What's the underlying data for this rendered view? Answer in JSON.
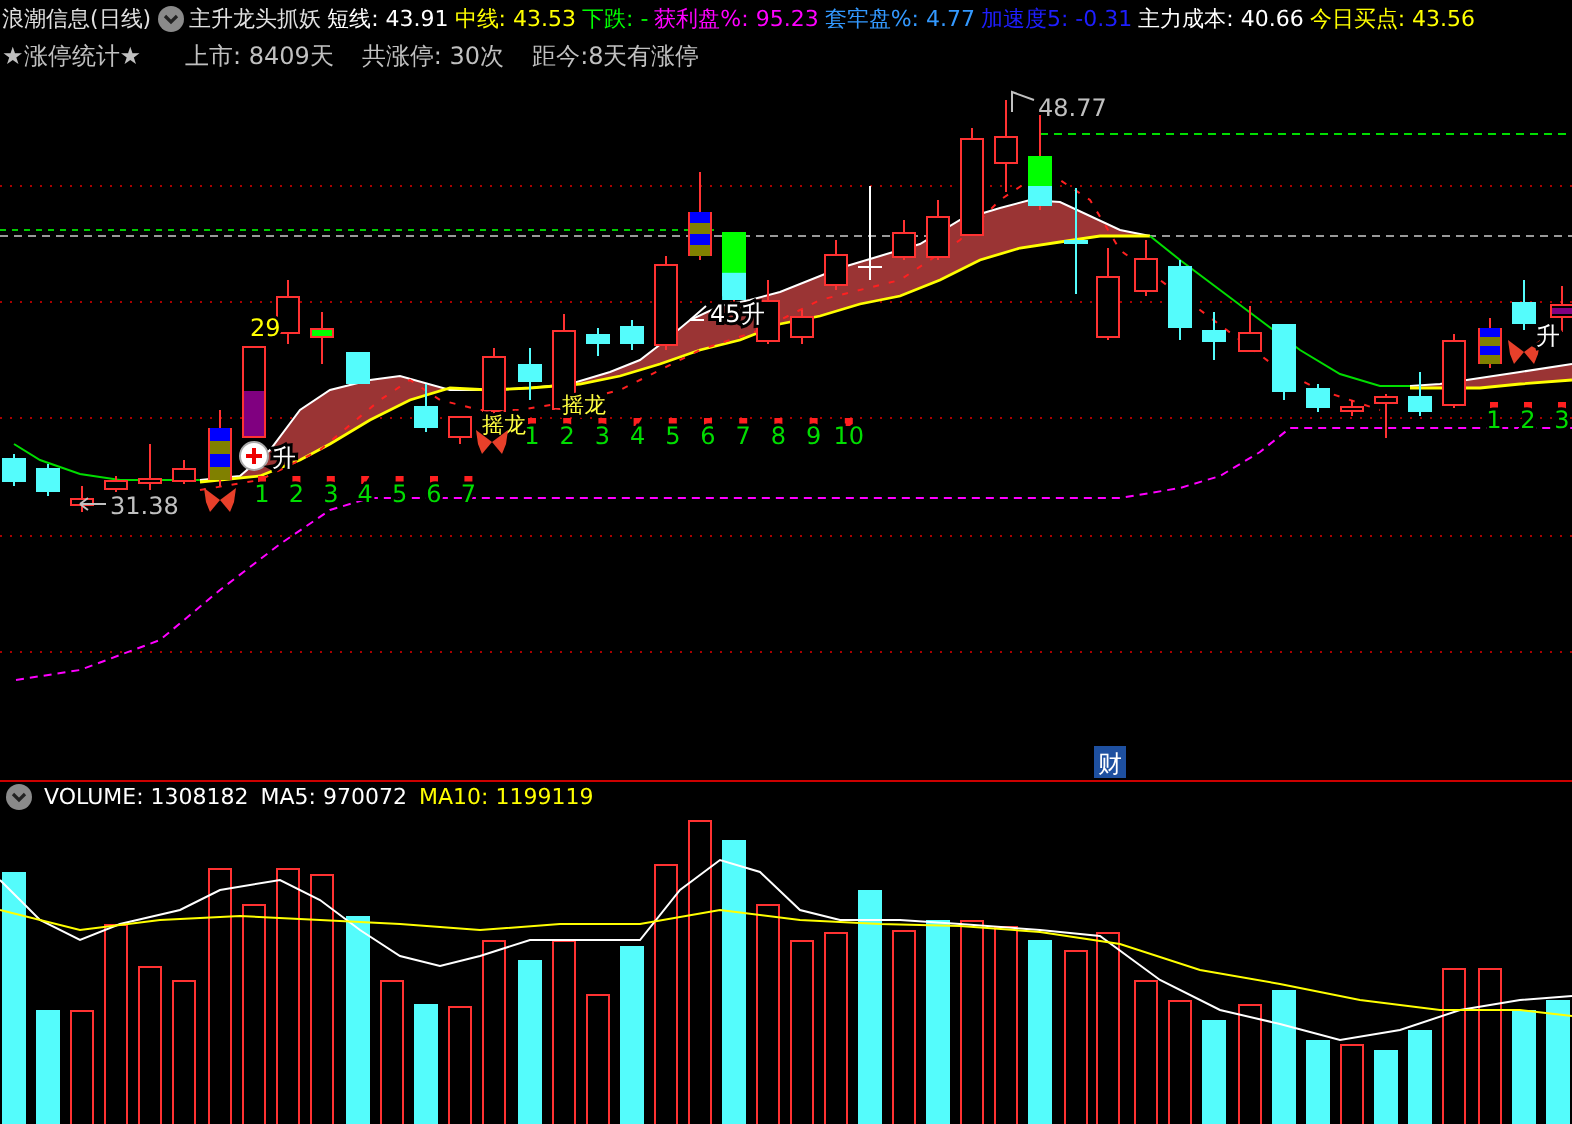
{
  "header": {
    "title": "浪潮信息(日线)",
    "indicator": "主升龙头抓妖",
    "readings": [
      {
        "text": "短线: 43.91",
        "color": "#ffffff"
      },
      {
        "text": "中线: 43.53",
        "color": "#ffff00"
      },
      {
        "text": "下跌: -",
        "color": "#00ff00"
      },
      {
        "text": "获利盘%: 95.23",
        "color": "#ff00ff"
      },
      {
        "text": "套牢盘%: 4.77",
        "color": "#3399ff"
      },
      {
        "text": "加速度5: -0.31",
        "color": "#1e1eff"
      },
      {
        "text": "主力成本: 40.66",
        "color": "#ffffff"
      },
      {
        "text": "今日买点: 43.56",
        "color": "#ffff00"
      }
    ]
  },
  "stats": [
    "★涨停统计★",
    "上市: 8409天",
    "共涨停: 30次",
    "距今:8天有涨停"
  ],
  "price_chart": {
    "low_label": "31.38",
    "high_label": "48.77",
    "count_label": "29",
    "angle_label": "45升",
    "rise_labels": [
      "升",
      "升"
    ],
    "signal_labels": [
      "摇龙",
      "摇龙"
    ],
    "count_runs": [
      [
        "1",
        "2",
        "3",
        "4",
        "5",
        "6",
        "7"
      ],
      [
        "1",
        "2",
        "3",
        "4",
        "5",
        "6",
        "7",
        "8",
        "9",
        "10"
      ],
      [
        "1",
        "2",
        "3"
      ]
    ],
    "badge": "财"
  },
  "volume": {
    "readings": [
      {
        "text": "VOLUME: 1308182",
        "color": "#ffffff"
      },
      {
        "text": "MA5: 970072",
        "color": "#ffffff"
      },
      {
        "text": "MA10: 1199119",
        "color": "#ffff00"
      }
    ]
  }
}
